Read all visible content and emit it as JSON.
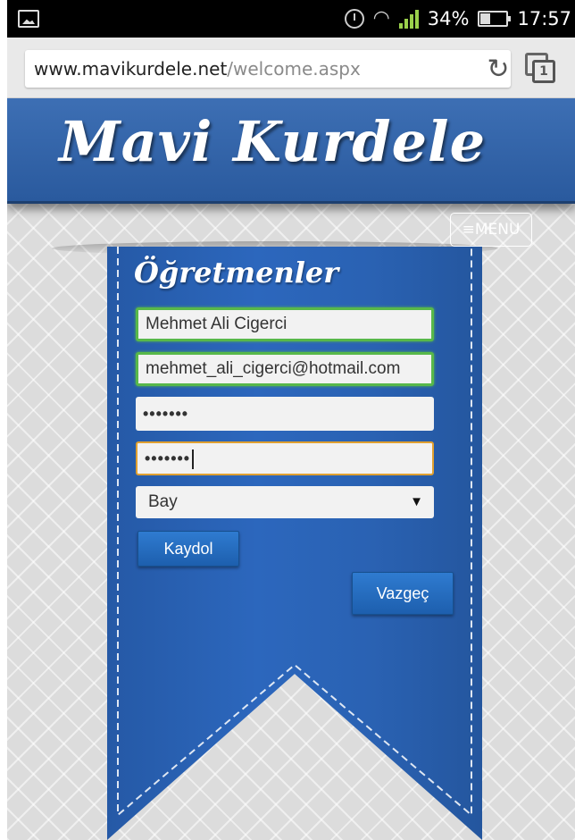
{
  "status_bar": {
    "battery_percent": "34%",
    "time": "17:57",
    "icons": [
      "image-icon",
      "alarm-icon",
      "wifi-icon",
      "signal-icon",
      "battery-icon"
    ]
  },
  "browser": {
    "url_domain": "www.mavikurdele.net",
    "url_path": "/welcome.aspx",
    "tab_count": "1"
  },
  "header": {
    "logo": "Mavi Kurdele",
    "menu_label": "≡MENU"
  },
  "form": {
    "title": "Öğretmenler",
    "name_value": "Mehmet Ali Cigerci",
    "email_value": "mehmet_ali_cigerci@hotmail.com",
    "password_value": "•••••••",
    "password_confirm_value": "•••••••",
    "gender_selected": "Bay",
    "register_label": "Kaydol",
    "cancel_label": "Vazgeç"
  },
  "colors": {
    "header_blue": "#2f62a8",
    "ribbon_blue": "#2a62b3",
    "valid_green": "#58b84a",
    "focus_orange": "#e0a030",
    "button_blue": "#2a70c2"
  }
}
